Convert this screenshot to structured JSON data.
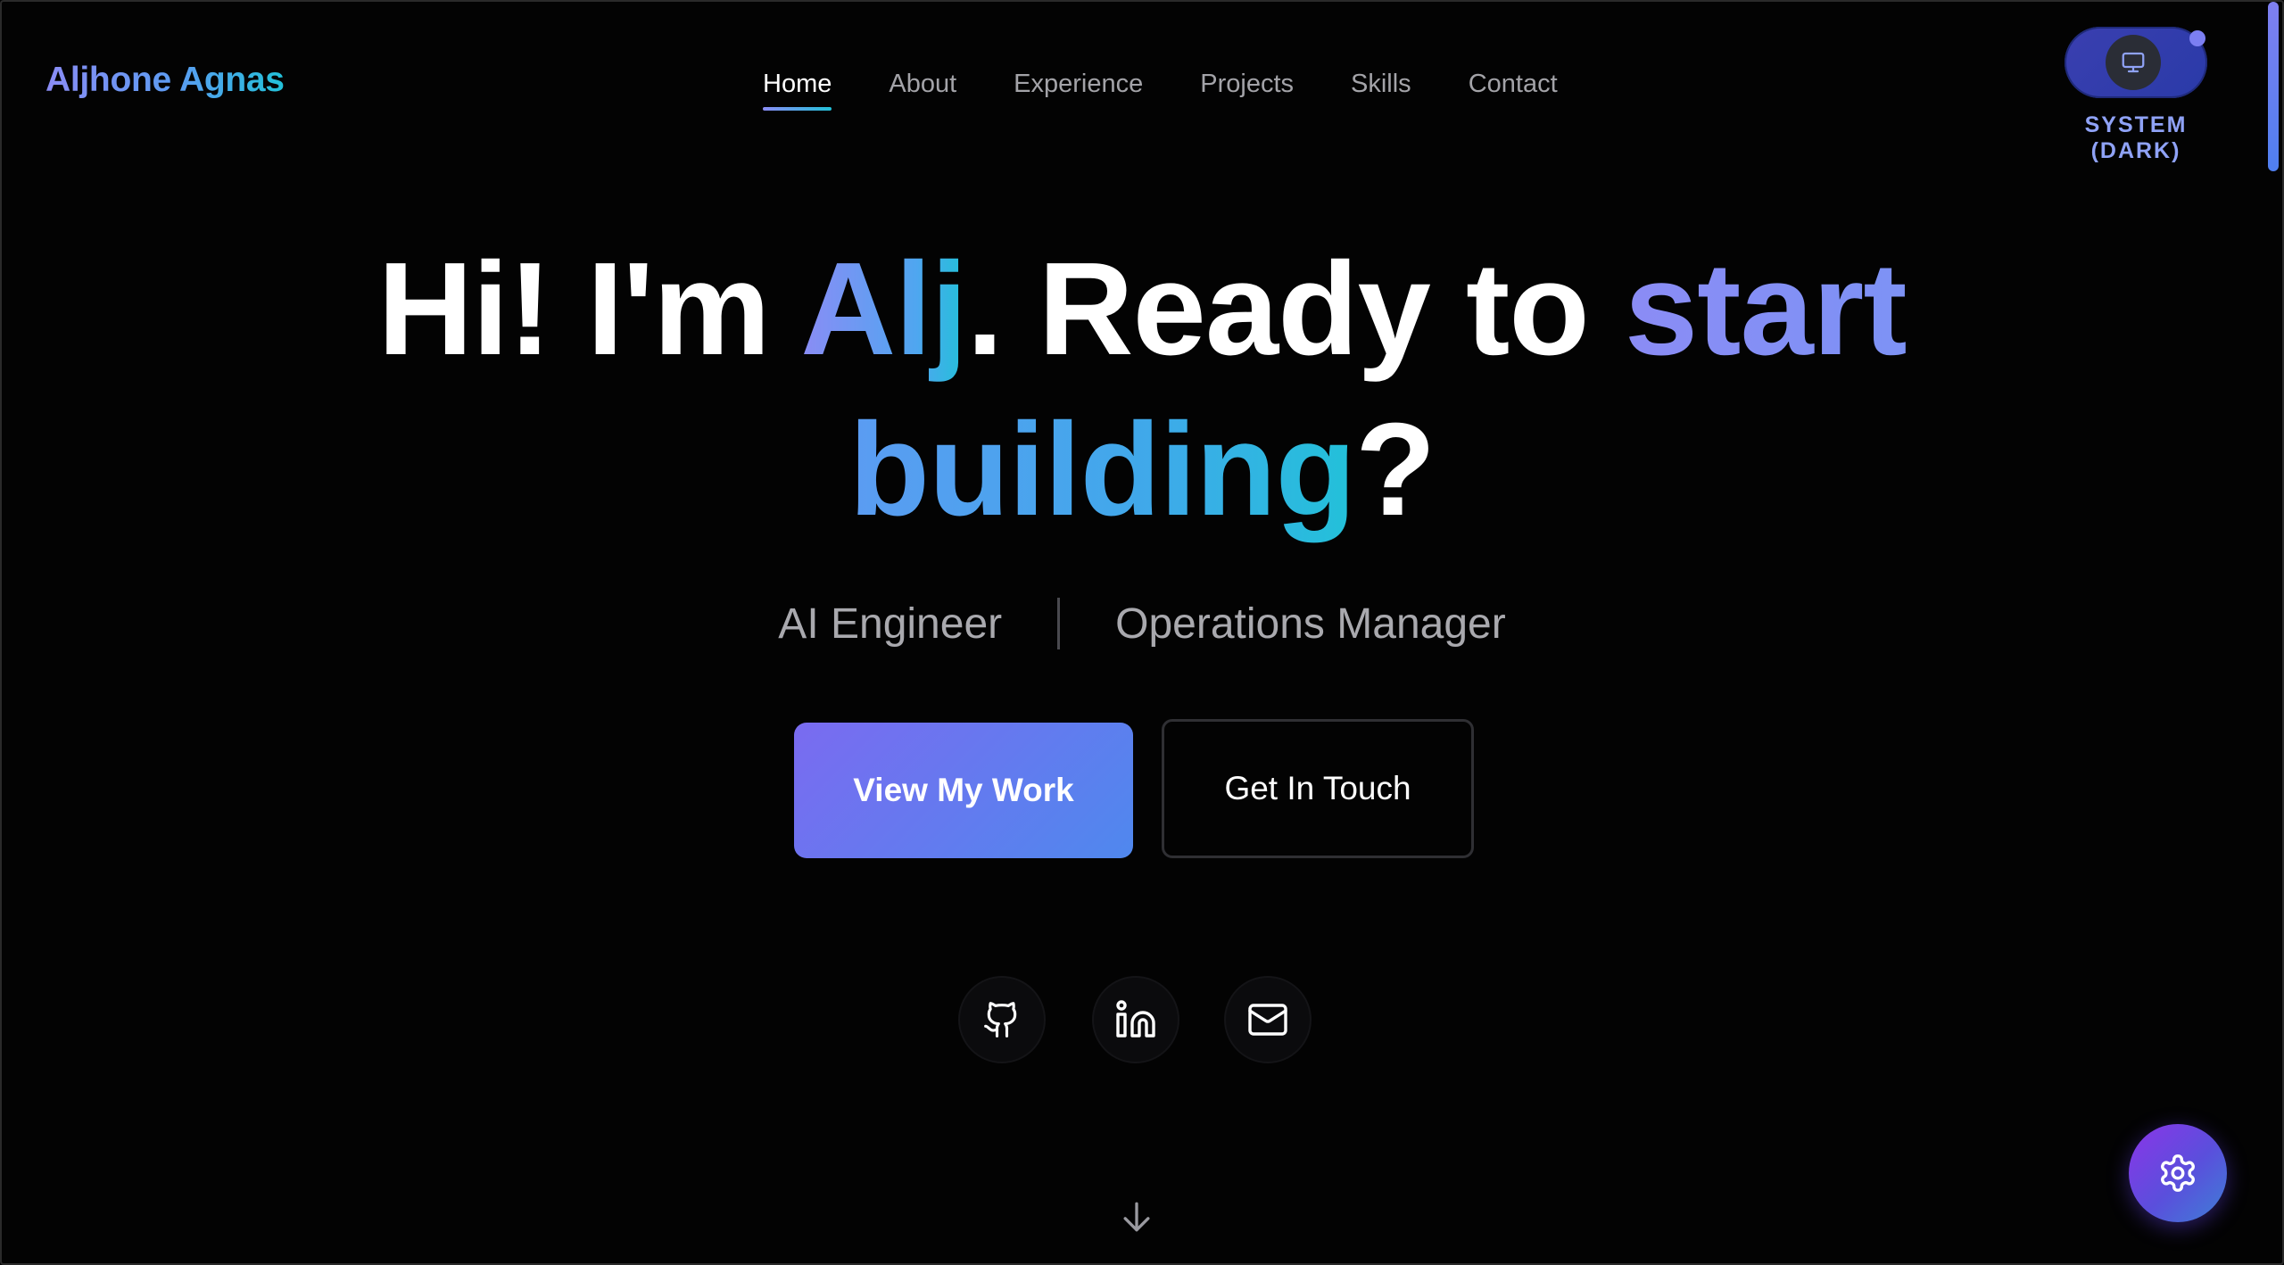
{
  "header": {
    "brand": "Aljhone Agnas",
    "nav": [
      {
        "label": "Home",
        "active": true
      },
      {
        "label": "About",
        "active": false
      },
      {
        "label": "Experience",
        "active": false
      },
      {
        "label": "Projects",
        "active": false
      },
      {
        "label": "Skills",
        "active": false
      },
      {
        "label": "Contact",
        "active": false
      }
    ],
    "theme": {
      "label": "SYSTEM (DARK)",
      "icon": "monitor-icon"
    }
  },
  "hero": {
    "title": {
      "p1": "Hi! I'm ",
      "name": "Alj",
      "p2": ". Ready to ",
      "start": "start",
      "building": "building",
      "p3": "?"
    },
    "roles": [
      "AI Engineer",
      "Operations Manager"
    ],
    "primary_button": "View My Work",
    "secondary_button": "Get In Touch",
    "social": [
      "github-icon",
      "linkedin-icon",
      "mail-icon"
    ],
    "scroll_icon": "arrow-down-icon"
  },
  "fab": {
    "icon": "gear-icon"
  },
  "colors": {
    "accent_start": "#8b8cf5",
    "accent_end": "#22c1d9",
    "background": "#030303"
  }
}
